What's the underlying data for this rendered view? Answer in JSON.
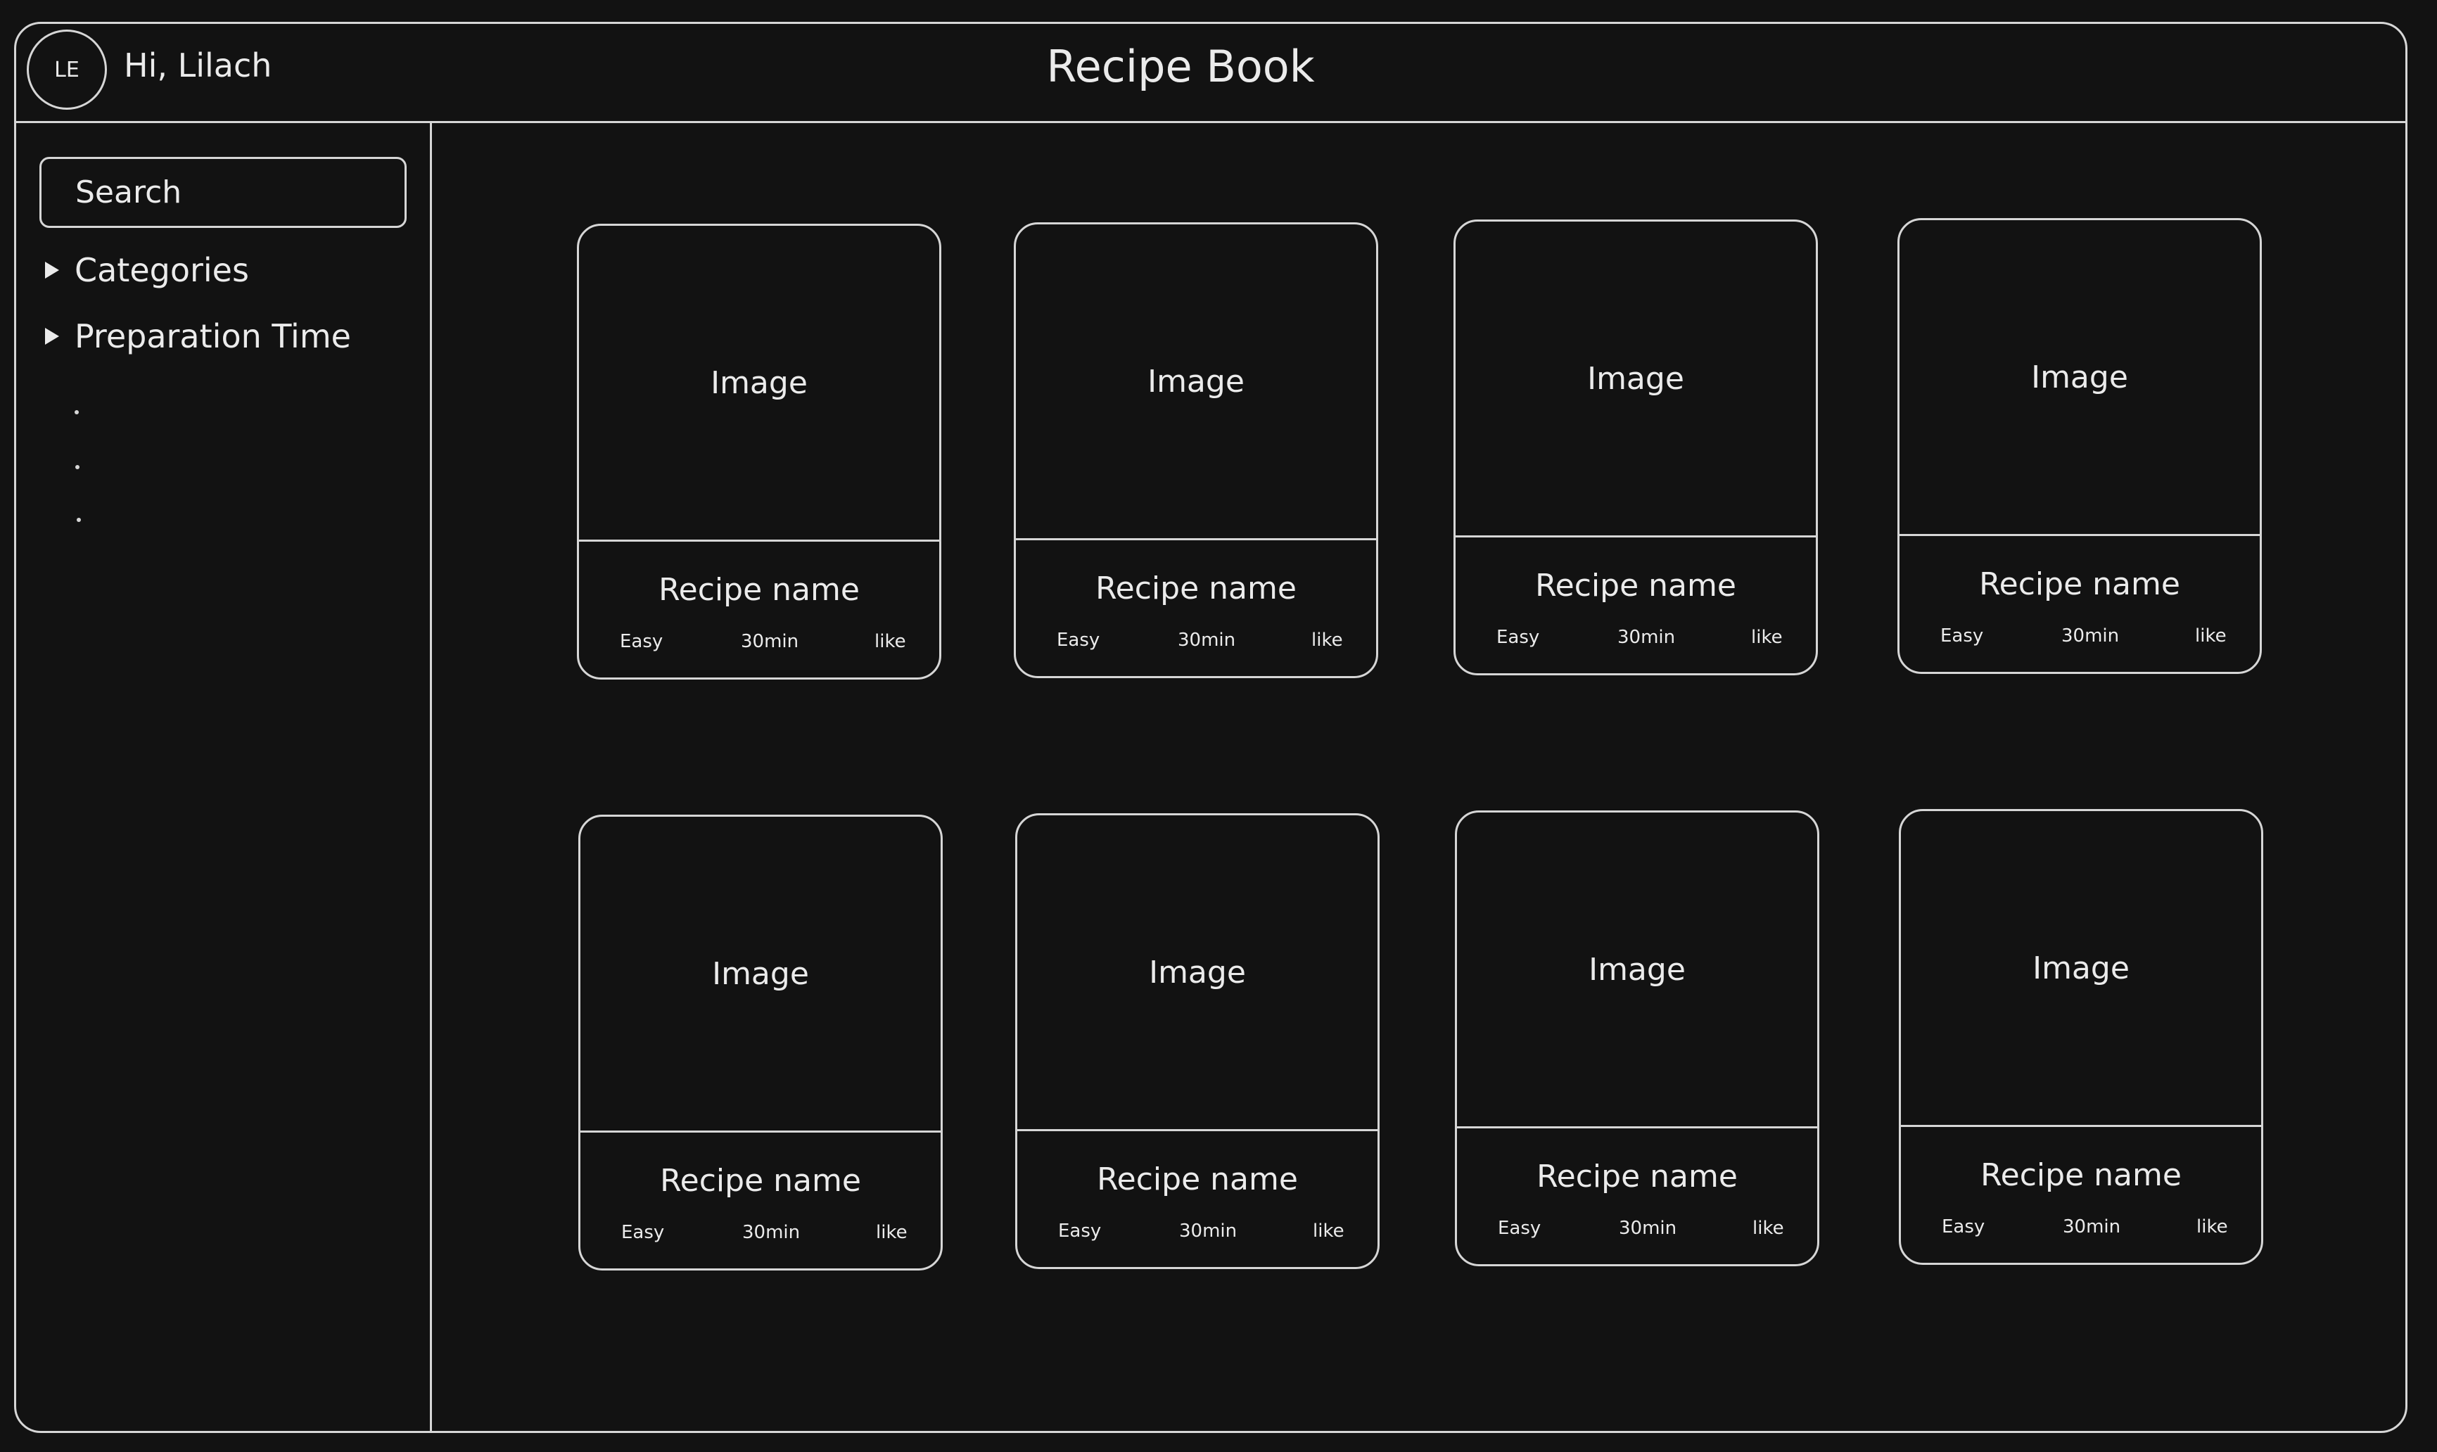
{
  "header": {
    "avatar_initials": "LE",
    "greeting": "Hi, Lilach",
    "title": "Recipe Book"
  },
  "sidebar": {
    "search_placeholder": "Search",
    "filters": [
      {
        "label": "Categories"
      },
      {
        "label": "Preparation Time"
      }
    ],
    "more_items": [
      ".",
      ".",
      "."
    ]
  },
  "recipes": [
    {
      "image": "Image",
      "name": "Recipe name",
      "difficulty": "Easy",
      "time": "30min",
      "like": "like"
    },
    {
      "image": "Image",
      "name": "Recipe name",
      "difficulty": "Easy",
      "time": "30min",
      "like": "like"
    },
    {
      "image": "Image",
      "name": "Recipe name",
      "difficulty": "Easy",
      "time": "30min",
      "like": "like"
    },
    {
      "image": "Image",
      "name": "Recipe name",
      "difficulty": "Easy",
      "time": "30min",
      "like": "like"
    },
    {
      "image": "Image",
      "name": "Recipe name",
      "difficulty": "Easy",
      "time": "30min",
      "like": "like"
    },
    {
      "image": "Image",
      "name": "Recipe name",
      "difficulty": "Easy",
      "time": "30min",
      "like": "like"
    },
    {
      "image": "Image",
      "name": "Recipe name",
      "difficulty": "Easy",
      "time": "30min",
      "like": "like"
    },
    {
      "image": "Image",
      "name": "Recipe name",
      "difficulty": "Easy",
      "time": "30min",
      "like": "like"
    }
  ]
}
